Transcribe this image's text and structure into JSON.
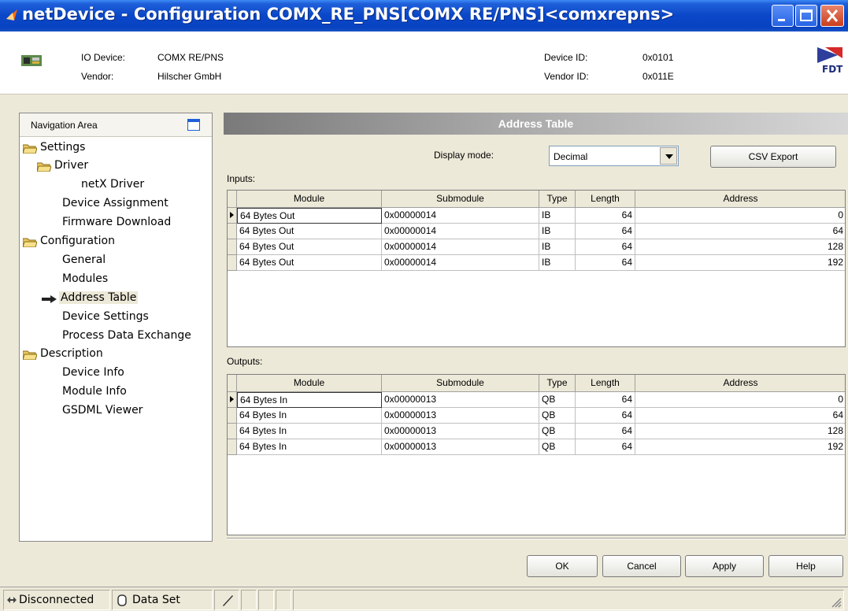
{
  "window": {
    "title": "netDevice - Configuration COMX_RE_PNS[COMX RE/PNS]<comxrepns>"
  },
  "header": {
    "io_device_label": "IO Device:",
    "io_device_value": "COMX RE/PNS",
    "vendor_label": "Vendor:",
    "vendor_value": "Hilscher GmbH",
    "device_id_label": "Device ID:",
    "device_id_value": "0x0101",
    "vendor_id_label": "Vendor ID:",
    "vendor_id_value": "0x011E",
    "logo_text": "FDT"
  },
  "nav": {
    "title": "Navigation Area",
    "items": [
      {
        "label": "Settings"
      },
      {
        "label": "Driver"
      },
      {
        "label": "netX Driver"
      },
      {
        "label": "Device Assignment"
      },
      {
        "label": "Firmware Download"
      },
      {
        "label": "Configuration"
      },
      {
        "label": "General"
      },
      {
        "label": "Modules"
      },
      {
        "label": "Address Table"
      },
      {
        "label": "Device Settings"
      },
      {
        "label": "Process Data Exchange"
      },
      {
        "label": "Description"
      },
      {
        "label": "Device Info"
      },
      {
        "label": "Module Info"
      },
      {
        "label": "GSDML Viewer"
      }
    ]
  },
  "panel": {
    "title": "Address Table",
    "display_mode_label": "Display mode:",
    "display_mode_value": "Decimal",
    "csv_export_label": "CSV Export",
    "inputs_label": "Inputs:",
    "outputs_label": "Outputs:"
  },
  "columns": [
    "Module",
    "Submodule",
    "Type",
    "Length",
    "Address"
  ],
  "inputs": [
    [
      "64 Bytes Out",
      "0x00000014",
      "IB",
      "64",
      "0"
    ],
    [
      "64 Bytes Out",
      "0x00000014",
      "IB",
      "64",
      "64"
    ],
    [
      "64 Bytes Out",
      "0x00000014",
      "IB",
      "64",
      "128"
    ],
    [
      "64 Bytes Out",
      "0x00000014",
      "IB",
      "64",
      "192"
    ]
  ],
  "outputs": [
    [
      "64 Bytes In",
      "0x00000013",
      "QB",
      "64",
      "0"
    ],
    [
      "64 Bytes In",
      "0x00000013",
      "QB",
      "64",
      "64"
    ],
    [
      "64 Bytes In",
      "0x00000013",
      "QB",
      "64",
      "128"
    ],
    [
      "64 Bytes In",
      "0x00000013",
      "QB",
      "64",
      "192"
    ]
  ],
  "buttons": {
    "ok": "OK",
    "cancel": "Cancel",
    "apply": "Apply",
    "help": "Help"
  },
  "status": {
    "connection": "Disconnected",
    "dataset": "Data Set"
  }
}
